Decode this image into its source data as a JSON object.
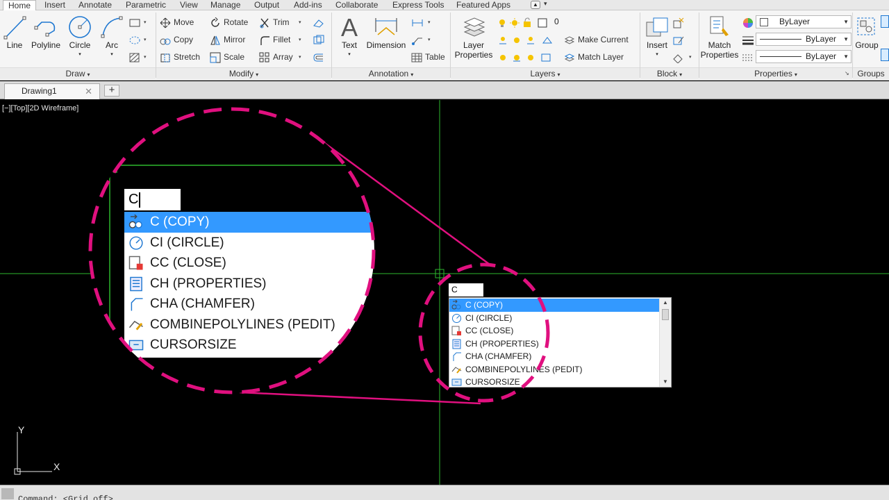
{
  "ribbon_tabs": [
    "Home",
    "Insert",
    "Annotate",
    "Parametric",
    "View",
    "Manage",
    "Output",
    "Add-ins",
    "Collaborate",
    "Express Tools",
    "Featured Apps"
  ],
  "draw": {
    "title": "Draw",
    "line": "Line",
    "polyline": "Polyline",
    "circle": "Circle",
    "arc": "Arc"
  },
  "modify": {
    "title": "Modify",
    "move": "Move",
    "rotate": "Rotate",
    "trim": "Trim",
    "copy": "Copy",
    "mirror": "Mirror",
    "fillet": "Fillet",
    "stretch": "Stretch",
    "scale": "Scale",
    "array": "Array"
  },
  "annotation": {
    "title": "Annotation",
    "text": "Text",
    "dimension": "Dimension",
    "table": "Table"
  },
  "layers": {
    "title": "Layers",
    "layer_properties": [
      "Layer",
      "Properties"
    ],
    "current_layer": "0",
    "make_current": "Make Current",
    "match_layer": "Match Layer"
  },
  "block": {
    "title": "Block",
    "insert": "Insert"
  },
  "properties": {
    "title": "Properties",
    "match_properties": [
      "Match",
      "Properties"
    ],
    "color": "ByLayer",
    "linetype": "ByLayer",
    "lineweight": "ByLayer"
  },
  "groups": {
    "title": "Groups",
    "group": "Group"
  },
  "document": {
    "tab": "Drawing1",
    "new_tab": "+"
  },
  "viewport": {
    "label": "[−][Top][2D Wireframe]"
  },
  "autocomplete": {
    "input": "C",
    "items": [
      {
        "label": "C (COPY)",
        "icon": "copy-icon",
        "selected": true
      },
      {
        "label": "CI (CIRCLE)",
        "icon": "circle-icon",
        "selected": false
      },
      {
        "label": "CC (CLOSE)",
        "icon": "close-icon",
        "selected": false
      },
      {
        "label": "CH (PROPERTIES)",
        "icon": "properties-icon",
        "selected": false
      },
      {
        "label": "CHA (CHAMFER)",
        "icon": "chamfer-icon",
        "selected": false
      },
      {
        "label": "COMBINEPOLYLINES (PEDIT)",
        "icon": "pedit-icon",
        "selected": false
      },
      {
        "label": "CURSORSIZE",
        "icon": "cursorsize-icon",
        "selected": false
      }
    ]
  },
  "ucs": {
    "x": "X",
    "y": "Y"
  },
  "command_line": "Command:  <Grid off>",
  "colors": {
    "accent_magenta": "#e0107f",
    "selection_blue": "#3399ff",
    "crosshair_green": "#2eb82e"
  }
}
